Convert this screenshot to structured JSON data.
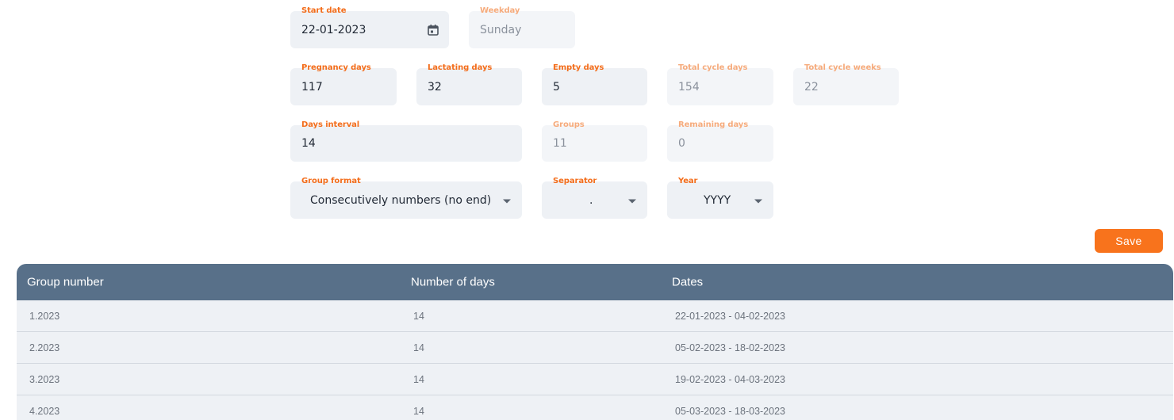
{
  "form": {
    "start_date": {
      "label": "Start date",
      "value": "22-01-2023"
    },
    "weekday": {
      "label": "Weekday",
      "value": "Sunday"
    },
    "pregnancy_days": {
      "label": "Pregnancy days",
      "value": "117"
    },
    "lactating_days": {
      "label": "Lactating days",
      "value": "32"
    },
    "empty_days": {
      "label": "Empty days",
      "value": "5"
    },
    "total_cycle_days": {
      "label": "Total cycle days",
      "value": "154"
    },
    "total_cycle_weeks": {
      "label": "Total cycle weeks",
      "value": "22"
    },
    "days_interval": {
      "label": "Days interval",
      "value": "14"
    },
    "groups": {
      "label": "Groups",
      "value": "11"
    },
    "remaining_days": {
      "label": "Remaining days",
      "value": "0"
    },
    "group_format": {
      "label": "Group format",
      "value": "Consecutively numbers (no end)"
    },
    "separator": {
      "label": "Separator",
      "value": "."
    },
    "year": {
      "label": "Year",
      "value": "YYYY"
    }
  },
  "actions": {
    "save_label": "Save"
  },
  "table": {
    "headers": {
      "group_number": "Group number",
      "number_of_days": "Number of days",
      "dates": "Dates"
    },
    "rows": [
      {
        "group": "1.2023",
        "days": "14",
        "dates": "22-01-2023 - 04-02-2023"
      },
      {
        "group": "2.2023",
        "days": "14",
        "dates": "05-02-2023 - 18-02-2023"
      },
      {
        "group": "3.2023",
        "days": "14",
        "dates": "19-02-2023 - 04-03-2023"
      },
      {
        "group": "4.2023",
        "days": "14",
        "dates": "05-03-2023 - 18-03-2023"
      }
    ]
  },
  "colors": {
    "accent": "#f8731c",
    "label": "#f36d1b",
    "label_readonly": "#f6ab7c",
    "header_bg": "#587089",
    "field_bg": "#eef1f5"
  },
  "icons": {
    "date_picker": "calendar-icon",
    "dropdown": "caret-down-icon"
  }
}
